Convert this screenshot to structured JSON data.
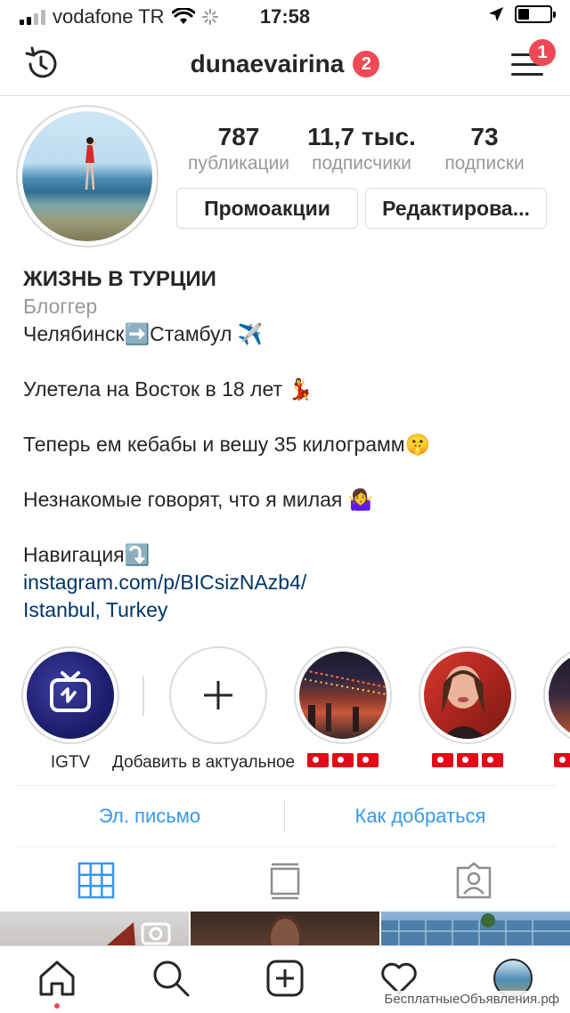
{
  "status_bar": {
    "carrier": "vodafone TR",
    "time": "17:58"
  },
  "header": {
    "username": "dunaevairina",
    "username_badge": "2",
    "menu_badge": "1"
  },
  "profile": {
    "stats": [
      {
        "value": "787",
        "label": "публикации"
      },
      {
        "value": "11,7 тыс.",
        "label": "подписчики"
      },
      {
        "value": "73",
        "label": "подписки"
      }
    ],
    "promo_button": "Промоакции",
    "edit_button": "Редактирова..."
  },
  "bio": {
    "name": "ЖИЗНЬ В ТУРЦИИ",
    "category": "Блоггер",
    "line1": "Челябинск➡️Стамбул ✈️",
    "line2": "Улетела на Восток в 18 лет 💃",
    "line3": "Теперь ем кебабы и вешу 35 килограмм🤫",
    "line4": "Незнакомые говорят, что я милая 🤷‍♀️",
    "line5": "Навигация⤵️",
    "link": "instagram.com/p/BICsizNAzb4/",
    "location": "Istanbul, Turkey"
  },
  "highlights": [
    {
      "label": "IGTV"
    },
    {
      "label": "Добавить в актуальное"
    },
    {
      "label": "🇹🇷🇹🇷🇹🇷"
    },
    {
      "label": "🇹🇷🇹🇷🇹🇷"
    },
    {
      "label": "🇹🇷"
    }
  ],
  "contact": {
    "email": "Эл. письмо",
    "directions": "Как добраться"
  },
  "watermark": "БесплатныеОбъявления.рф",
  "colors": {
    "accent": "#3897f0",
    "badge": "#ed4956",
    "link": "#003569",
    "muted": "#999999"
  }
}
